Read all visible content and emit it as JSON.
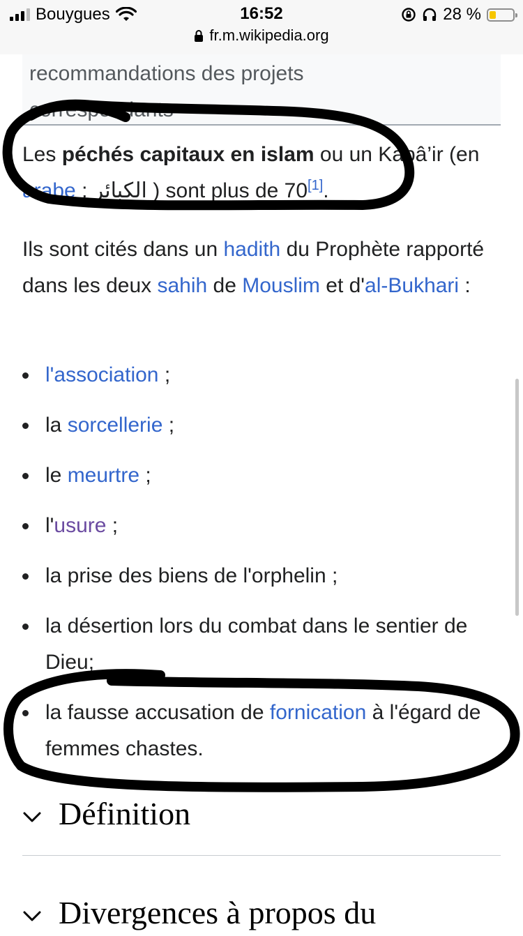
{
  "status": {
    "carrier": "Bouygues",
    "time": "16:52",
    "battery": "28 %",
    "url": "fr.m.wikipedia.org"
  },
  "notice": {
    "text": "recommandations des projets",
    "text2": "correspondants"
  },
  "intro": {
    "pre": "Les ",
    "bold": "péchés capitaux en islam",
    "mid": " ou un Kabâ’ir (en ",
    "arabe_link": "arabe",
    "arabic": " : الكبائر ",
    "post": ") sont plus de 70",
    "ref": "[1]",
    "end": "."
  },
  "cited": {
    "t1": "Ils sont cités dans un ",
    "hadith": "hadith",
    "t2": " du Prophète rapporté dans les deux ",
    "sahih": "sahih",
    "t3": " de ",
    "mouslim": "Mouslim",
    "t4": " et d'",
    "bukhari": "al-Bukhari",
    "t5": " :"
  },
  "list": [
    {
      "pre": "",
      "link": "l'association",
      "post": " ;"
    },
    {
      "pre": "la ",
      "link": "sorcellerie",
      "post": " ;"
    },
    {
      "pre": "le ",
      "link": "meurtre",
      "post": " ;"
    },
    {
      "pre": "l'",
      "link": "usure",
      "post": " ;"
    },
    {
      "pre": "la prise des biens de l'orphelin ;",
      "link": "",
      "post": ""
    },
    {
      "pre": "la désertion lors du combat dans le sentier de Dieu;",
      "link": "",
      "post": ""
    },
    {
      "pre": "la fausse accusation de ",
      "link": "fornication",
      "post": " à l'égard de femmes chastes."
    }
  ],
  "sections": {
    "definition": "Définition",
    "divergences": "Divergences à propos du"
  },
  "colors": {
    "link": "#3366cc",
    "visited": "#6b4ba1",
    "text": "#202122",
    "marker": "#000000"
  },
  "icons": [
    "signal-icon",
    "wifi-icon",
    "lock-icon",
    "rotation-lock-icon",
    "headphones-icon",
    "battery-icon",
    "chevron-down-icon"
  ]
}
